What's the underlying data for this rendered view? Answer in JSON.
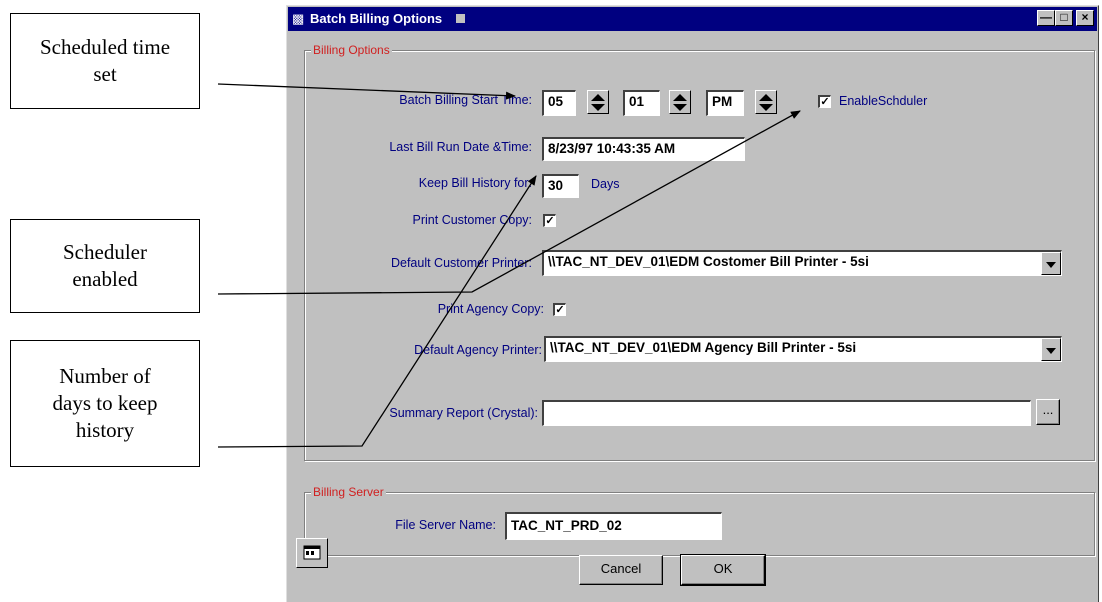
{
  "callouts": {
    "scheduled_time": "Scheduled time\nset",
    "scheduler_enabled": "Scheduler\nenabled",
    "history_days": "Number of\ndays to keep\nhistory"
  },
  "window": {
    "title": "Batch Billing Options",
    "icon": "app-icon"
  },
  "billing_options": {
    "legend": "Billing Options",
    "start_time_label": "Batch Billing Start Time:",
    "hour": "05",
    "minute": "01",
    "ampm": "PM",
    "enable_scheduler_label": "EnableSchduler",
    "enable_scheduler_checked": true,
    "last_run_label": "Last Bill Run Date &Time:",
    "last_run_value": "8/23/97  10:43:35 AM",
    "keep_history_label": "Keep Bill History for:",
    "keep_history_value": "30",
    "keep_history_unit": "Days",
    "print_customer_label": "Print Customer Copy:",
    "print_customer_checked": true,
    "default_customer_printer_label": "Default Customer Printer:",
    "default_customer_printer_value": "\\\\TAC_NT_DEV_01\\EDM Costomer Bill Printer - 5si",
    "print_agency_label": "Print Agency Copy:",
    "print_agency_checked": true,
    "default_agency_printer_label": "Default Agency Printer:",
    "default_agency_printer_value": "\\\\TAC_NT_DEV_01\\EDM Agency Bill Printer - 5si",
    "summary_report_label": "Summary Report (Crystal):",
    "summary_report_value": "",
    "browse_label": "..."
  },
  "billing_server": {
    "legend": "Billing Server",
    "file_server_label": "File Server Name:",
    "file_server_value": "TAC_NT_PRD_02"
  },
  "buttons": {
    "cancel": "Cancel",
    "ok": "OK"
  }
}
